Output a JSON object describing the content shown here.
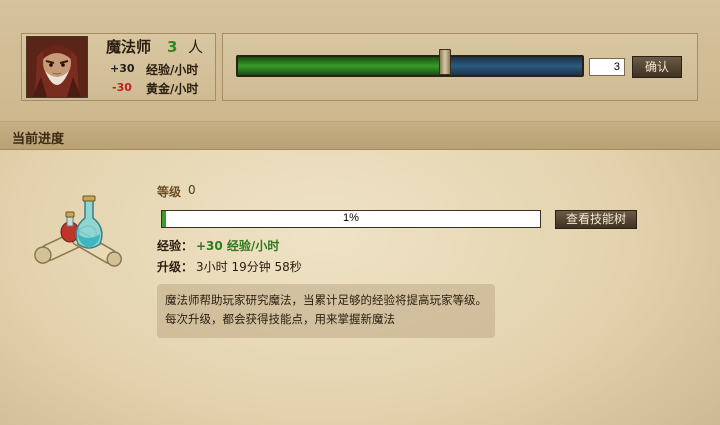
{
  "unit": {
    "name": "魔法师",
    "count": "3",
    "count_unit": "人",
    "exp_rate": {
      "value": "+30",
      "label": "经验/小时",
      "color": "#1f1f1f"
    },
    "gold_rate": {
      "value": "-30",
      "label": "黄金/小时",
      "color": "#c0201c"
    },
    "portrait_icon": "wizard-portrait"
  },
  "slider": {
    "level": 0.6,
    "input_value": "3",
    "confirm_label": "确认"
  },
  "section": {
    "title": "当前进度"
  },
  "progress": {
    "level_label": "等级",
    "level_value": "0",
    "percent_text": "1%",
    "percent": 1,
    "skill_tree_label": "查看技能树",
    "exp_label": "经验：",
    "exp_value": "+30 经验/小时",
    "upgrade_label": "升级：",
    "upgrade_value": "3小时 19分钟 58秒",
    "description_line1": "魔法师帮助玩家研究魔法，当累计足够的经验将提高玩家等级。",
    "description_line2": "每次升级，都会获得技能点，用来掌握新魔法",
    "icon": "potion-scroll-icon"
  },
  "colors": {
    "slider_fill": "#3a9a2a",
    "slider_track": "#2d5a80",
    "progress_fill": "#3a9a2a",
    "count_green": "#2f8a1e"
  }
}
